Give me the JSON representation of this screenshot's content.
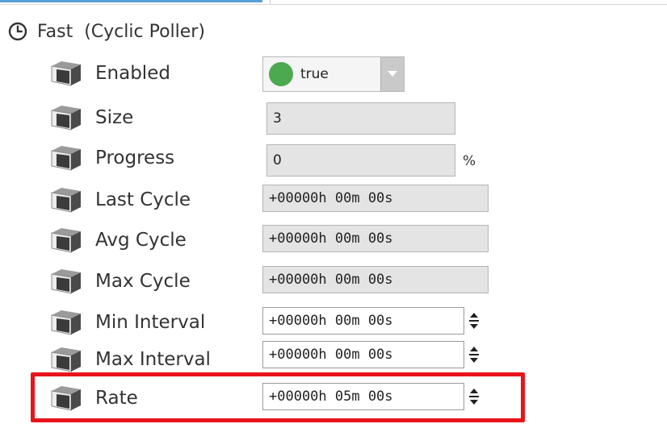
{
  "header": {
    "icon": "clock-icon",
    "name": "Fast",
    "type": "(Cyclic Poller)"
  },
  "rows": [
    {
      "label": "Enabled",
      "kind": "dropdown",
      "value": "true",
      "status_color": "#4ca94f"
    },
    {
      "label": "Size",
      "kind": "readonly-number",
      "value": "3"
    },
    {
      "label": "Progress",
      "kind": "readonly-number",
      "value": "0",
      "unit": "%"
    },
    {
      "label": "Last Cycle",
      "kind": "readonly-duration",
      "value": "+00000h 00m 00s"
    },
    {
      "label": "Avg Cycle",
      "kind": "readonly-duration",
      "value": "+00000h 00m 00s"
    },
    {
      "label": "Max Cycle",
      "kind": "readonly-duration",
      "value": "+00000h 00m 00s"
    },
    {
      "label": "Min Interval",
      "kind": "editable-duration",
      "value": "+00000h 00m 00s"
    },
    {
      "label": "Max Interval",
      "kind": "editable-duration",
      "value": "+00000h 00m 00s"
    },
    {
      "label": "Rate",
      "kind": "editable-duration",
      "value": "+00000h 05m 00s"
    }
  ],
  "highlight_color": "#e8141a",
  "row_icon": "slot-cube-icon"
}
